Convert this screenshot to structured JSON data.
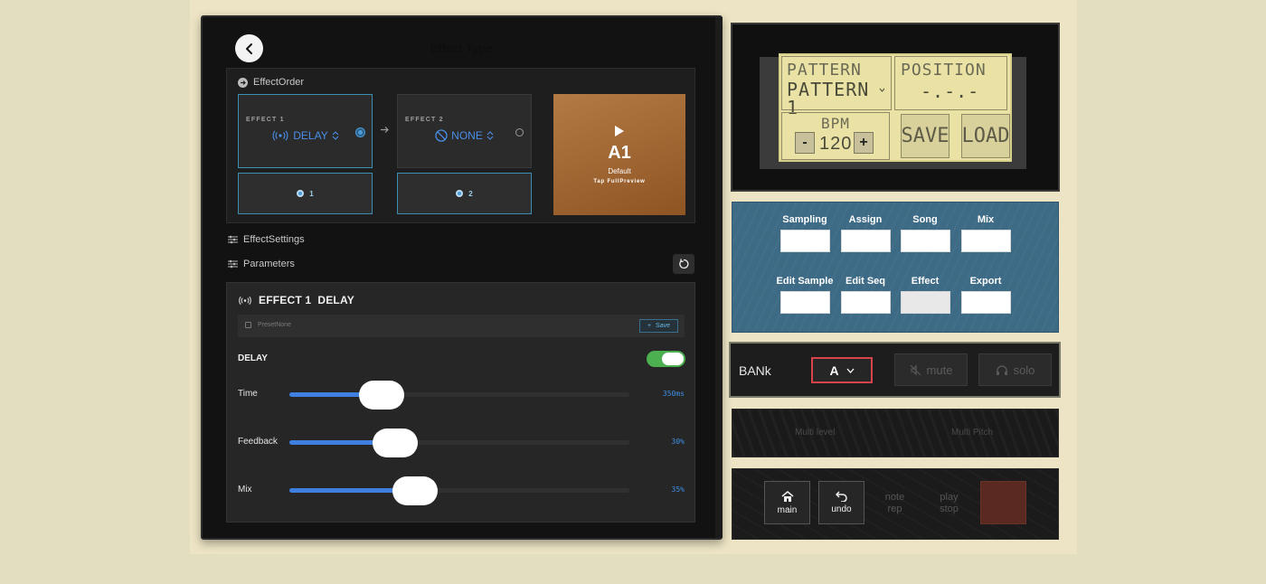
{
  "effect_type": {
    "title": "Effect Type",
    "effect_order": {
      "heading": "EffectOrder",
      "effect1": {
        "label": "EFFECT 1",
        "value": "DELAY",
        "slot": "1"
      },
      "effect2": {
        "label": "EFFECT 2",
        "value": "NONE",
        "slot": "2"
      },
      "preview": {
        "name": "A1",
        "subtitle": "Default",
        "hint": "Tap FullPreview"
      }
    },
    "effect_settings_heading": "EffectSettings",
    "parameters_heading": "Parameters",
    "params_panel": {
      "title": "EFFECT 1  DELAY",
      "preset_name": "PresetNone",
      "save_label": "Save",
      "section_label": "DELAY",
      "enabled": true,
      "params": [
        {
          "name": "Time",
          "value": "350ms",
          "level": 0.27
        },
        {
          "name": "Feedback",
          "value": "30%",
          "level": 0.31
        },
        {
          "name": "Mix",
          "value": "35%",
          "level": 0.37
        }
      ]
    }
  },
  "lcd": {
    "pattern_label": "PATTERN",
    "pattern_value": "PATTERN 1",
    "position_label": "POSITION",
    "position_value": "-.-.-",
    "bpm_label": "BPM",
    "bpm_value": "120",
    "minus": "-",
    "plus": "+",
    "save": "SAVE",
    "load": "LOAD"
  },
  "modes": {
    "row1": [
      "Sampling",
      "Assign",
      "Song",
      "Mix"
    ],
    "row2": [
      "Edit Sample",
      "Edit Seq",
      "Effect",
      "Export"
    ],
    "selected": "Effect"
  },
  "bank": {
    "label": "BANk",
    "value": "A",
    "mute": "mute",
    "solo": "solo"
  },
  "multi": {
    "level": "Multi level",
    "pitch": "Multi Pitch"
  },
  "transport": {
    "main": "main",
    "undo": "undo",
    "note_rep_1": "note",
    "note_rep_2": "rep",
    "play_stop_1": "play",
    "play_stop_2": "stop"
  },
  "colors": {
    "accent_blue": "#3e7fe0",
    "toggle_green": "#4caf50",
    "bank_select_border": "#d9434b",
    "mode_panel": "#3d6a85",
    "lcd_background": "#e9e2a4",
    "preview_card": "#a86c3a"
  }
}
